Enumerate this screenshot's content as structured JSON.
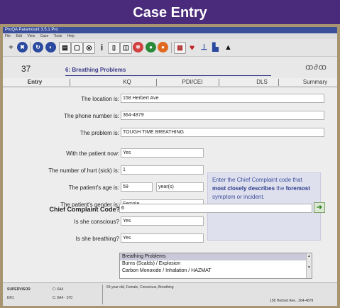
{
  "banner": {
    "title": "Case Entry"
  },
  "window": {
    "title": "ProQA Paramount 3.5.1 Pro"
  },
  "menu": [
    "File",
    "Edit",
    "View",
    "Case",
    "Tools",
    "Help"
  ],
  "toolbar": {
    "icons": [
      "plus-icon",
      "stop-icon",
      "rotate-icon",
      "circle-icon",
      "document-icon",
      "page-icon",
      "target-icon",
      "info-icon",
      "dispatch-icon",
      "split-icon",
      "hazard-icon",
      "go-icon",
      "record-icon",
      "calendar-icon",
      "heart-icon",
      "arrow-down-icon",
      "chart-icon",
      "warning-icon"
    ]
  },
  "case": {
    "number": "37",
    "title": "6: Breathing Problems",
    "logo": "ꝏ∂ꝏ"
  },
  "tabs": [
    {
      "label": "Entry",
      "active": true
    },
    {
      "label": "KQ",
      "active": false
    },
    {
      "label": "PDI/CEI",
      "active": false
    },
    {
      "label": "DLS",
      "active": false
    },
    {
      "label": "Summary",
      "active": false
    }
  ],
  "form": {
    "location_label": "The location is:",
    "location_value": "158 Herbert Ave",
    "phone_label": "The phone number is:",
    "phone_value": "364-4879",
    "problem_label": "The problem is:",
    "problem_value": "TOUGH TIME BREATHING",
    "with_patient_label": "With the patient now:",
    "with_patient_value": "Yes",
    "num_hurt_label": "The number of hurt (sick) is:",
    "num_hurt_value": "1",
    "age_label": "The patient's age is:",
    "age_value": "59",
    "age_unit": "year(s)",
    "gender_label": "The patient's gender is:",
    "gender_value": "Female",
    "conscious_label": "Is she conscious?",
    "conscious_value": "Yes",
    "breathing_label": "Is she breathing?",
    "breathing_value": "Yes"
  },
  "hint": {
    "part1": "Enter the Chief Complaint code that",
    "bold1": "most closely describes",
    "part2": "the",
    "bold2": "foremost",
    "part3": "symptom or incident."
  },
  "chief_complaint": {
    "label": "Chief Complaint Code?",
    "value": "6",
    "options": [
      "Breathing Problems",
      "Burns (Scalds) / Explosion",
      "Carbon Monoxide / Inhalation / HAZMAT"
    ],
    "selected_index": 0
  },
  "status": {
    "role": "SUPERVISOR",
    "role_value": "C: 6A4",
    "unit": "ER1",
    "unit_value": "C: 6A4 - 370",
    "summary": "59 year old, Female, Conscious, Breathing",
    "address": "158 Herbert Ave., 364-4879"
  },
  "colors": {
    "banner": "#4a2a7a",
    "accent": "#3a4e9a",
    "frame": "#a89470"
  }
}
